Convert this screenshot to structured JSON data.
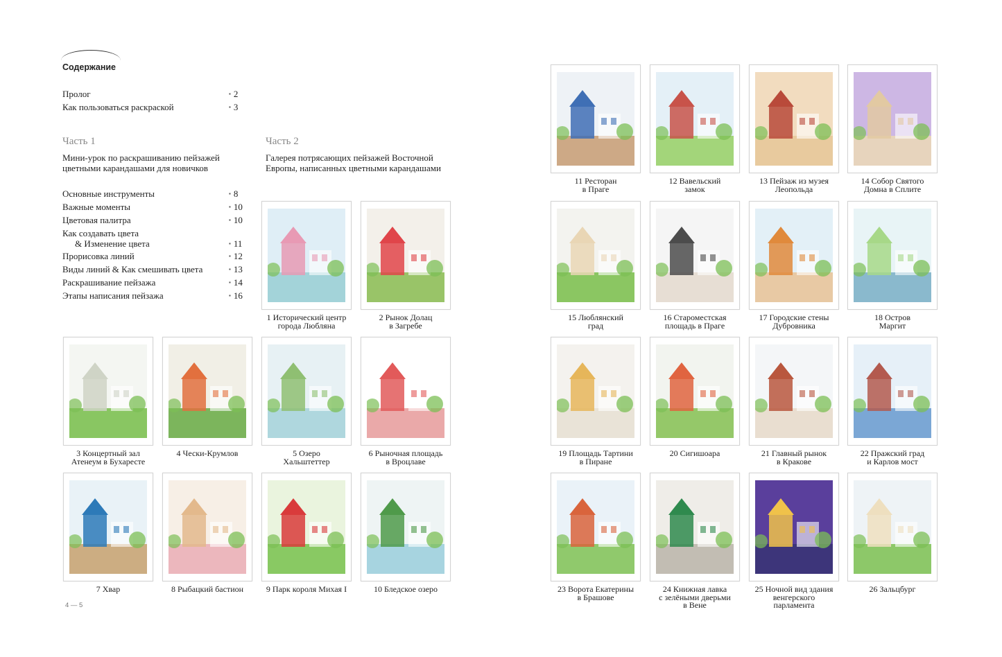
{
  "toc": {
    "title": "Содержание",
    "intro": [
      {
        "label": "Пролог",
        "page": "2"
      },
      {
        "label": "Как пользоваться раскраской",
        "page": "3"
      }
    ],
    "part1": {
      "heading": "Часть 1",
      "description": "Мини-урок по раскрашиванию пейзажей цветными карандашами для новичков",
      "items": [
        {
          "label": "Основные инструменты",
          "page": "8"
        },
        {
          "label": "Важные моменты",
          "page": "10"
        },
        {
          "label": "Цветовая палитра",
          "page": "10"
        },
        {
          "label": "Как создавать цвета",
          "page": ""
        },
        {
          "label": "& Изменение цвета",
          "page": "11"
        },
        {
          "label": "Прорисовка линий",
          "page": "12"
        },
        {
          "label": "Виды линий & Как смешивать цвета",
          "page": "13"
        },
        {
          "label": "Раскрашивание пейзажа",
          "page": "14"
        },
        {
          "label": "Этапы написания пейзажа",
          "page": "16"
        }
      ]
    },
    "part2": {
      "heading": "Часть 2",
      "description": "Галерея потрясающих пейзажей Восточной Европы, написанных цветными карандашами"
    }
  },
  "gallery": [
    {
      "caption": [
        "1 Исторический центр",
        "города Любляна"
      ],
      "sky": "#dfeef6",
      "accent": "#e89ab4",
      "ground": "#9ccfd6"
    },
    {
      "caption": [
        "2 Рынок Долац",
        "в Загребе"
      ],
      "sky": "#f3f0ea",
      "accent": "#e0454a",
      "ground": "#8fbf5a"
    },
    {
      "caption": [
        "3 Концертный зал",
        "Атенеум в Бухаресте"
      ],
      "sky": "#f4f6f2",
      "accent": "#cfd4c6",
      "ground": "#7dc152"
    },
    {
      "caption": [
        "4 Чески-Крумлов"
      ],
      "sky": "#f1efe6",
      "accent": "#e2703e",
      "ground": "#6fae4c"
    },
    {
      "caption": [
        "5 Озеро",
        "Хальштеттер"
      ],
      "sky": "#e7f1f4",
      "accent": "#8fbf72",
      "ground": "#a8d4dc"
    },
    {
      "caption": [
        "6 Рыночная площадь",
        "в Вроцлаве"
      ],
      "sky": "#ffffff",
      "accent": "#e25a5a",
      "ground": "#e8a0a0"
    },
    {
      "caption": [
        "7 Хвар"
      ],
      "sky": "#e9f2f7",
      "accent": "#2d7ab8",
      "ground": "#c9a574"
    },
    {
      "caption": [
        "8 Рыбацкий бастион"
      ],
      "sky": "#f7efe6",
      "accent": "#e3b98c",
      "ground": "#eab0b8"
    },
    {
      "caption": [
        "9 Парк короля Михая I"
      ],
      "sky": "#eaf4de",
      "accent": "#d93b3b",
      "ground": "#7ec455"
    },
    {
      "caption": [
        "10 Бледское озеро"
      ],
      "sky": "#eef4f4",
      "accent": "#4f9a4a",
      "ground": "#9fd0de"
    },
    {
      "caption": [
        "11 Ресторан",
        "в Праге"
      ],
      "sky": "#eef2f6",
      "accent": "#3f6fb5",
      "ground": "#c9a17a"
    },
    {
      "caption": [
        "12 Вавельский",
        "замок"
      ],
      "sky": "#e4f0f7",
      "accent": "#c8534a",
      "ground": "#9bd16b"
    },
    {
      "caption": [
        "13 Пейзаж из музея",
        "Леопольда"
      ],
      "sky": "#f2dcbf",
      "accent": "#b94a3a",
      "ground": "#e7c89a"
    },
    {
      "caption": [
        "14 Собор Святого",
        "Домна в Сплите"
      ],
      "sky": "#cdb7e4",
      "accent": "#e2c9a2",
      "ground": "#ead7b8"
    },
    {
      "caption": [
        "15 Люблянский",
        "град"
      ],
      "sky": "#f3f3ef",
      "accent": "#e9d6b5",
      "ground": "#7fc152"
    },
    {
      "caption": [
        "16 Староместская",
        "площадь в Праге"
      ],
      "sky": "#f5f5f5",
      "accent": "#4c4c4c",
      "ground": "#e6dcd0"
    },
    {
      "caption": [
        "17 Городские стены",
        "Дубровника"
      ],
      "sky": "#e3f0f7",
      "accent": "#e08a3c",
      "ground": "#e8c49a"
    },
    {
      "caption": [
        "18 Остров",
        "Маргит"
      ],
      "sky": "#e8f4f6",
      "accent": "#a7d888",
      "ground": "#7fb3c9"
    },
    {
      "caption": [
        "19 Площадь Тартини",
        "в Пиране"
      ],
      "sky": "#f4f2ee",
      "accent": "#e6b65a",
      "ground": "#e8e1d4"
    },
    {
      "caption": [
        "20 Сигишоара"
      ],
      "sky": "#f2f4ef",
      "accent": "#e06440",
      "ground": "#8bc35a"
    },
    {
      "caption": [
        "21 Главный рынок",
        "в Кракове"
      ],
      "sky": "#f4f6f8",
      "accent": "#b9573e",
      "ground": "#e8dccb"
    },
    {
      "caption": [
        "22 Пражский град",
        "и Карлов мост"
      ],
      "sky": "#e6f0f8",
      "accent": "#b35a4f",
      "ground": "#6f9fd0"
    },
    {
      "caption": [
        "23 Ворота Екатерины",
        "в Брашове"
      ],
      "sky": "#eaf2f8",
      "accent": "#d9643c",
      "ground": "#86c45c"
    },
    {
      "caption": [
        "24 Книжная лавка",
        "с зелёными дверьми",
        "в Вене"
      ],
      "sky": "#efede8",
      "accent": "#2f8a4e",
      "ground": "#bdb7ad"
    },
    {
      "caption": [
        "25 Ночной вид здания",
        "венгерского",
        "парламента"
      ],
      "sky": "#5a3f9c",
      "accent": "#f0c24a",
      "ground": "#3a3477"
    },
    {
      "caption": [
        "26 Зальцбург"
      ],
      "sky": "#eef3f6",
      "accent": "#eedfbf",
      "ground": "#82c35a"
    }
  ],
  "folio": "4 — 5"
}
